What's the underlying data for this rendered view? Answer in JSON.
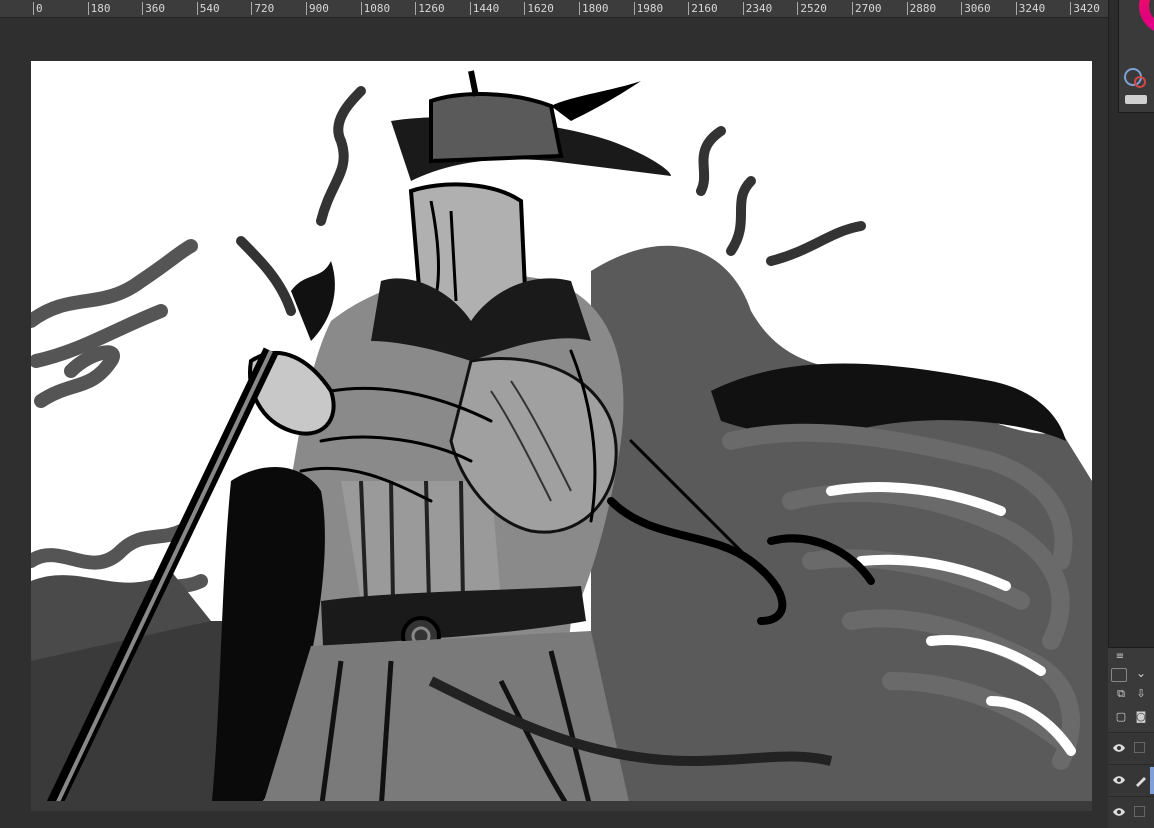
{
  "ruler": {
    "labels": [
      "0",
      "180",
      "360",
      "540",
      "720",
      "900",
      "1080",
      "1260",
      "1440",
      "1620",
      "1800",
      "1980",
      "2160",
      "2340",
      "2520",
      "2700",
      "2880",
      "3060",
      "3240",
      "3420"
    ]
  },
  "canvas": {
    "background": "#ffffff",
    "ink": "#000000"
  },
  "color_panel": {
    "wheel_color": "#ff1e7a",
    "main_color": "#7fa0d8",
    "sub_color": "#d04848"
  },
  "layer_panel": {
    "menu_icon": "hamburger-icon",
    "tools": [
      "layer-mask-icon",
      "dropdown-icon",
      "new-layer-icon",
      "transfer-icon",
      "new-vector-icon",
      "new-folder-icon"
    ],
    "layers": [
      {
        "visible": true,
        "icon": "eye-icon"
      },
      {
        "visible": true,
        "icon": "eye-icon",
        "editing": true
      },
      {
        "visible": true,
        "icon": "eye-icon"
      }
    ]
  }
}
